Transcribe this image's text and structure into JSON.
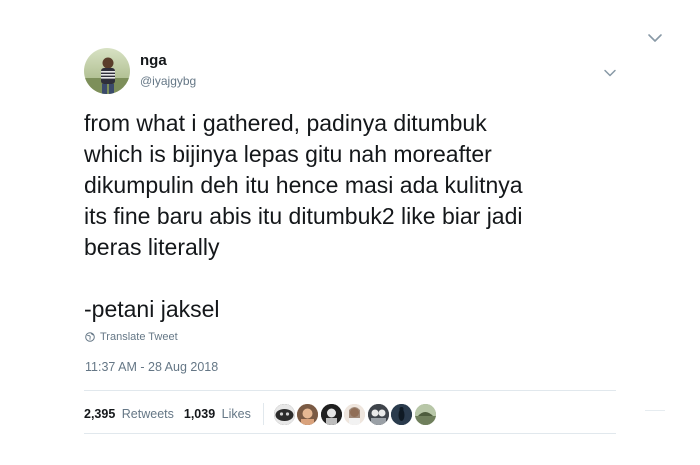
{
  "user": {
    "display_name": "nga",
    "handle": "@iyajgybg"
  },
  "tweet": {
    "lines": [
      "from what i gathered, padinya ditumbuk",
      "which is bijinya lepas gitu nah moreafter",
      "dikumpulin deh itu hence masi ada kulitnya",
      "its fine baru abis itu ditumbuk2 like biar jadi",
      "beras literally"
    ],
    "signature": "-petani jaksel",
    "translate_label": "Translate Tweet",
    "timestamp": "11:37 AM - 28 Aug 2018"
  },
  "stats": {
    "retweets_count": "2,395",
    "retweets_label": "Retweets",
    "likes_count": "1,039",
    "likes_label": "Likes"
  },
  "likers": [
    {
      "icon": "liker-avatar-1",
      "color": "#3a3a3a"
    },
    {
      "icon": "liker-avatar-2",
      "color": "#b98b6a"
    },
    {
      "icon": "liker-avatar-3",
      "color": "#2a2a2a"
    },
    {
      "icon": "liker-avatar-4",
      "color": "#d9c7b8"
    },
    {
      "icon": "liker-avatar-5",
      "color": "#4a4f57"
    },
    {
      "icon": "liker-avatar-6",
      "color": "#1f3347"
    },
    {
      "icon": "liker-avatar-7",
      "color": "#8a9a78"
    }
  ],
  "colors": {
    "text_primary": "#14171a",
    "text_secondary": "#657786",
    "divider": "#e1e8ed"
  }
}
